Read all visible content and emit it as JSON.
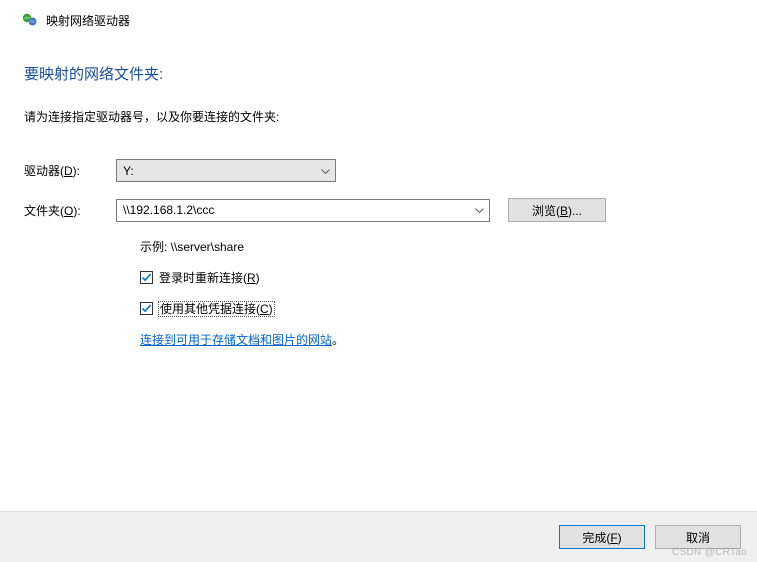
{
  "window": {
    "title": "映射网络驱动器"
  },
  "header": {
    "title": "要映射的网络文件夹:"
  },
  "instruction": "请为连接指定驱动器号，以及你要连接的文件夹:",
  "form": {
    "drive": {
      "label_pre": "驱动器(",
      "label_key": "D",
      "label_post": "):",
      "value": "Y:"
    },
    "folder": {
      "label_pre": "文件夹(",
      "label_key": "O",
      "label_post": "):",
      "value": "\\\\192.168.1.2\\ccc"
    },
    "browse": {
      "label_pre": "浏览(",
      "label_key": "B",
      "label_post": ")..."
    },
    "example": "示例: \\\\server\\share",
    "reconnect": {
      "checked": true,
      "label_pre": "登录时重新连接(",
      "label_key": "R",
      "label_post": ")"
    },
    "other_creds": {
      "checked": true,
      "label_pre": "使用其他凭据连接(",
      "label_key": "C",
      "label_post": ")"
    },
    "link": "连接到可用于存储文档和图片的网站",
    "period": "。"
  },
  "footer": {
    "finish": {
      "label_pre": "完成(",
      "label_key": "F",
      "label_post": ")"
    },
    "cancel": "取消"
  },
  "watermark": "CSDN @CRTao"
}
